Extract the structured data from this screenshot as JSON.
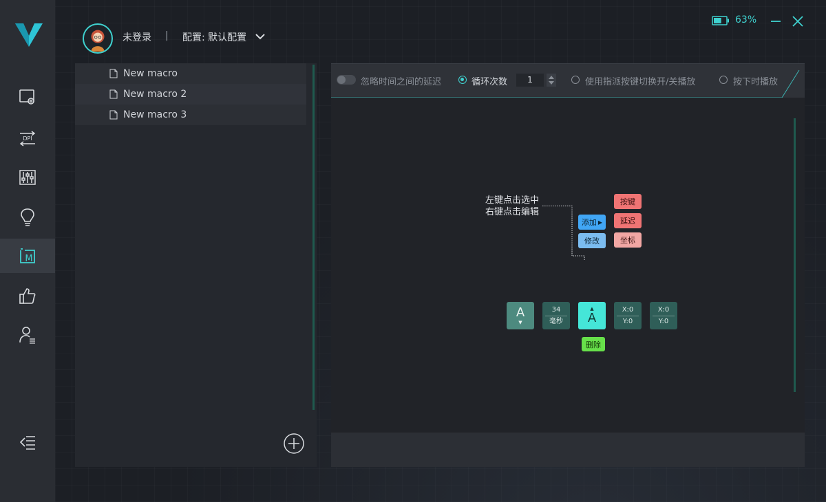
{
  "header": {
    "login_status": "未登录",
    "separator": "|",
    "config_label": "配置: 默认配置"
  },
  "window": {
    "battery_percent": "63%",
    "battery_level": 0.63
  },
  "sidebar": {
    "items": [
      {
        "icon": "screen-settings-icon"
      },
      {
        "icon": "dpi-icon",
        "label": "DPI"
      },
      {
        "icon": "equalizer-icon"
      },
      {
        "icon": "lightbulb-icon"
      },
      {
        "icon": "macro-icon",
        "label": "M",
        "active": true
      },
      {
        "icon": "thumbs-up-icon"
      },
      {
        "icon": "user-list-icon"
      }
    ],
    "collapse_icon": "collapse-menu-icon"
  },
  "macros": {
    "items": [
      {
        "label": "New macro"
      },
      {
        "label": "New macro 2"
      },
      {
        "label": "New macro 3"
      }
    ]
  },
  "toolbar": {
    "ignore_delay_label": "忽略时间之间的延迟",
    "loop_count_label": "循环次数",
    "loop_count_value": "1",
    "toggle_switch_label": "使用指派按键切换开/关播放",
    "hold_play_label": "按下时播放"
  },
  "editor": {
    "hint_line1": "左键点击选中",
    "hint_line2": "右键点击编辑",
    "add_label": "添加",
    "modify_label": "修改",
    "key_label": "按键",
    "delay_label": "延迟",
    "coord_label": "坐标",
    "delete_label": "删除",
    "blocks": {
      "key_down": "A",
      "delay_value": "34",
      "delay_unit": "毫秒",
      "key_up": "A",
      "pos1_x": "X:0",
      "pos1_y": "Y:0",
      "pos2_x": "X:0",
      "pos2_y": "Y:0"
    }
  },
  "colors": {
    "accent": "#3fd2d0",
    "sidebar_bg": "#2a2d33",
    "panel_bg": "#25282e"
  }
}
